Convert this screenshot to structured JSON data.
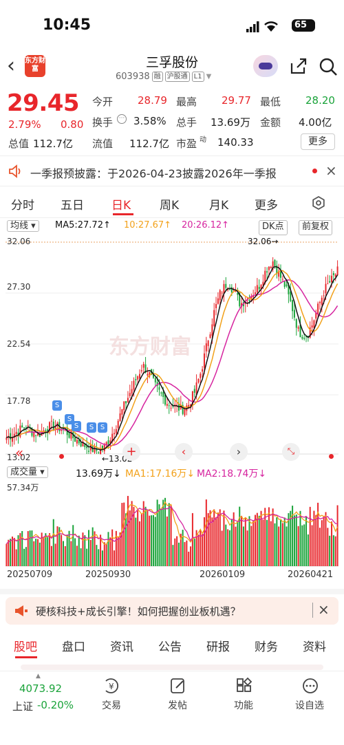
{
  "status": {
    "time": "10:45",
    "battery": "65"
  },
  "header": {
    "logo": "东方财富",
    "title": "三孚股份",
    "code": "603938",
    "tags": [
      "融",
      "沪股通",
      "L1"
    ]
  },
  "quote": {
    "price": "29.45",
    "pct": "2.79%",
    "change": "0.80",
    "open_label": "今开",
    "open": "28.79",
    "high_label": "最高",
    "high": "29.77",
    "low_label": "最低",
    "low": "28.20",
    "turnover_label": "换手",
    "turnover": "3.58%",
    "volume_label": "总手",
    "volume": "13.69万",
    "amount_label": "金额",
    "amount": "4.00亿",
    "mktcap_label": "总值",
    "mktcap": "112.7亿",
    "float_label": "流值",
    "float": "112.7亿",
    "pe_label": "市盈",
    "pe_sup": "动",
    "pe": "140.33",
    "more": "更多"
  },
  "notice": "一季报预披露：于2026-04-23披露2026年一季报",
  "tabs": [
    "分时",
    "五日",
    "日K",
    "周K",
    "月K",
    "更多"
  ],
  "ma_bar": {
    "select": "均线",
    "ma5": "MA5:27.72↑",
    "ma10": "10:27.67↑",
    "ma20": "20:26.12↑",
    "dk": "DK点",
    "fq": "前复权"
  },
  "axis": {
    "p1": "32.06",
    "p2": "27.30",
    "p3": "22.54",
    "p4": "17.78",
    "p5": "13.02",
    "high_mark": "32.06→",
    "low_mark": "←13.02",
    "vol_max": "57.34万"
  },
  "vol_bar": {
    "select": "成交量",
    "vol": "13.69万↓",
    "ma1": "MA1:17.16万↓",
    "ma2": "MA2:18.74万↓"
  },
  "dates": [
    "20250709",
    "20250930",
    "20260109",
    "20260421"
  ],
  "banner": "硬核科技+成长引擎！如何把握创业板机遇？",
  "bottom_tabs": [
    "股吧",
    "盘口",
    "资讯",
    "公告",
    "研报",
    "财务",
    "资料"
  ],
  "index": {
    "value": "4073.92",
    "name": "上证",
    "pct": "-0.20%"
  },
  "nav": [
    "交易",
    "发帖",
    "功能",
    "设自选"
  ],
  "colors": {
    "up": "#e8262b",
    "down": "#1aa33a",
    "ma5": "#111111",
    "ma10": "#f2a11a",
    "ma20": "#d6249f"
  },
  "chart_data": {
    "type": "candlestick",
    "ylim": [
      13.02,
      32.06
    ],
    "high": 32.06,
    "low": 13.02,
    "close_trend": [
      14.5,
      14.8,
      15.2,
      15.5,
      15.0,
      14.8,
      15.3,
      15.6,
      15.4,
      15.1,
      14.6,
      14.2,
      13.8,
      13.5,
      13.3,
      13.6,
      14.5,
      15.8,
      17.2,
      18.5,
      19.8,
      21.0,
      20.2,
      19.0,
      18.2,
      17.5,
      17.3,
      17.0,
      17.4,
      18.6,
      20.5,
      23.2,
      25.8,
      27.6,
      28.4,
      27.8,
      26.5,
      26.9,
      27.5,
      28.2,
      29.6,
      30.4,
      29.2,
      28.0,
      26.2,
      24.0,
      23.6,
      24.5,
      26.2,
      27.8,
      28.6,
      29.45
    ]
  }
}
